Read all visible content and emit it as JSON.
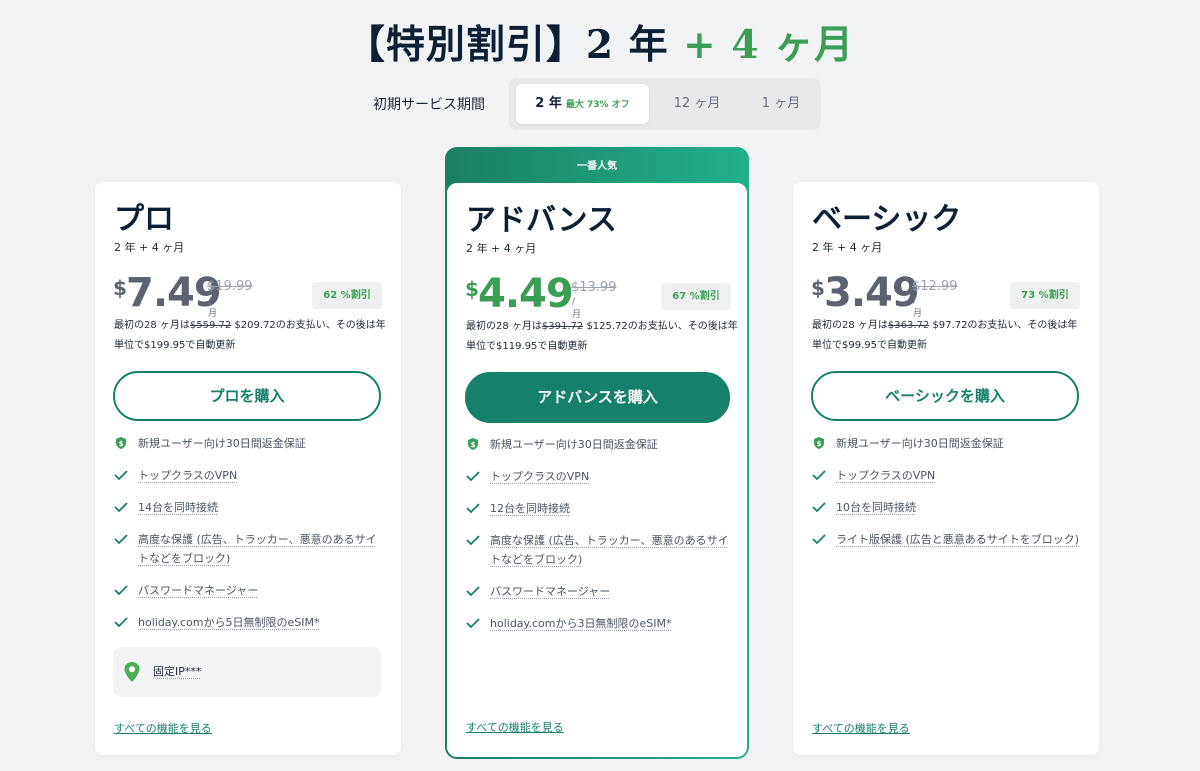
{
  "header": {
    "title_main": "【特別割引】2 年",
    "title_accent": "+ 4 ヶ月"
  },
  "period": {
    "label": "初期サービス期間",
    "options": [
      {
        "label": "2 年",
        "badge": "最大 73% オフ"
      },
      {
        "label": "12 ヶ月"
      },
      {
        "label": "1 ヶ月"
      }
    ]
  },
  "plans": [
    {
      "name": "プロ",
      "term": "2 年 + 4 ヶ月",
      "currency": "$",
      "price": "7.49",
      "old_price": "$19.99",
      "per": "/月",
      "discount": "62 %割引",
      "billing_prefix": "最初の28 ヶ月は",
      "billing_strike": "$559.72",
      "billing_rest": " $209.72のお支払い、その後は年単位で$199.95で自動更新",
      "buy_label": "プロを購入",
      "features": [
        "新規ユーザー向け30日間返金保証",
        "トップクラスのVPN",
        "14台を同時接続",
        "高度な保護 (広告、トラッカー、悪意のあるサイトなどをブロック)",
        "パスワードマネージャー",
        "holiday.comから5日無制限のeSIM*"
      ],
      "extra": "固定IP***",
      "see_all": "すべての機能を見る"
    },
    {
      "ribbon": "一番人気",
      "name": "アドバンス",
      "term": "2 年 + 4 ヶ月",
      "currency": "$",
      "price": "4.49",
      "old_price": "$13.99",
      "per": "/月",
      "discount": "67 %割引",
      "billing_prefix": "最初の28 ヶ月は",
      "billing_strike": "$391.72",
      "billing_rest": " $125.72のお支払い、その後は年単位で$119.95で自動更新",
      "buy_label": "アドバンスを購入",
      "features": [
        "新規ユーザー向け30日間返金保証",
        "トップクラスのVPN",
        "12台を同時接続",
        "高度な保護 (広告、トラッカー、悪意のあるサイトなどをブロック)",
        "パスワードマネージャー",
        "holiday.comから3日無制限のeSIM*"
      ],
      "see_all": "すべての機能を見る"
    },
    {
      "name": "ベーシック",
      "term": "2 年 + 4 ヶ月",
      "currency": "$",
      "price": "3.49",
      "old_price": "$12.99",
      "per": "/月",
      "discount": "73 %割引",
      "billing_prefix": "最初の28 ヶ月は",
      "billing_strike": "$363.72",
      "billing_rest": " $97.72のお支払い、その後は年単位で$99.95で自動更新",
      "buy_label": "ベーシックを購入",
      "features": [
        "新規ユーザー向け30日間返金保証",
        "トップクラスのVPN",
        "10台を同時接続",
        "ライト版保護 (広告と悪意あるサイトをブロック)"
      ],
      "see_all": "すべての機能を見る"
    }
  ],
  "colors": {
    "brand_green": "#17806a",
    "accent_green": "#3c9e55",
    "title_navy": "#0c1f33"
  }
}
